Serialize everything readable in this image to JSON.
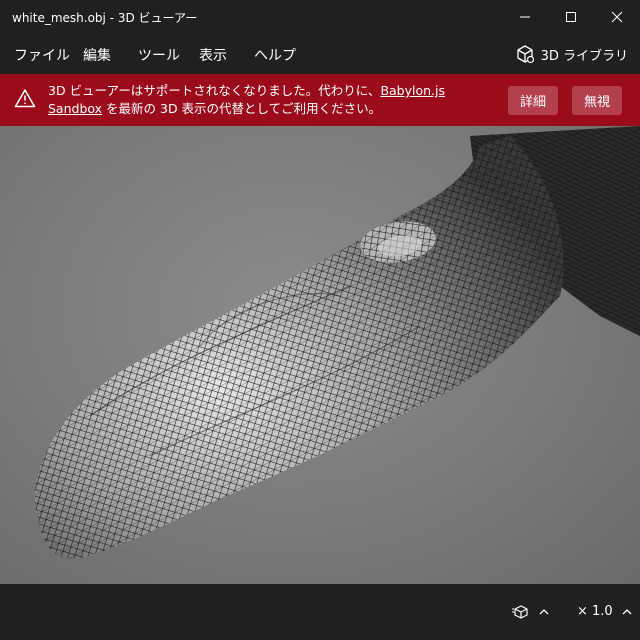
{
  "window": {
    "title": "white_mesh.obj - 3D ビューアー"
  },
  "menu": {
    "items": [
      "ファイル",
      "編集",
      "ツール",
      "表示",
      "ヘルプ"
    ],
    "library_label": "3D ライブラリ"
  },
  "banner": {
    "text_before": "3D ビューアーはサポートされなくなりました。代わりに、",
    "link_text": "Babylon.js Sandbox",
    "text_after": " を最新の 3D 表示の代替としてご利用ください。",
    "details_label": "詳細",
    "dismiss_label": "無視",
    "background_color": "#9b0b1c"
  },
  "status": {
    "zoom_label": "× 1.0"
  },
  "icons": {
    "minimize": "minimize-icon",
    "maximize": "maximize-icon",
    "close": "close-icon",
    "library": "cube-icon",
    "warning": "warning-icon",
    "view_cube": "view-cube-icon",
    "expand": "chevron-up-icon"
  }
}
